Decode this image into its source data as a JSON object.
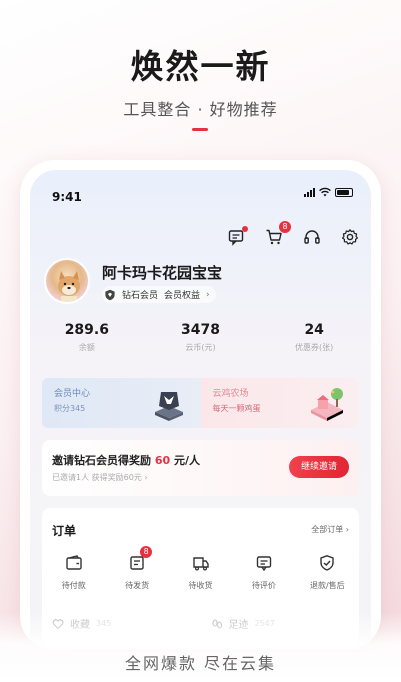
{
  "hero": {
    "title": "焕然一新",
    "subtitle": "工具整合 · 好物推荐"
  },
  "status_bar": {
    "time": "9:41"
  },
  "top_icons": [
    {
      "name": "message-icon",
      "has_dot": true
    },
    {
      "name": "cart-icon",
      "badge": "8"
    },
    {
      "name": "headset-icon"
    },
    {
      "name": "gear-icon"
    }
  ],
  "profile": {
    "name": "阿卡玛卡花园宝宝",
    "member_level": "钻石会员",
    "member_rights": "会员权益"
  },
  "stats": [
    {
      "value": "289.6",
      "label": "余额"
    },
    {
      "value": "3478",
      "label": "云币(元)"
    },
    {
      "value": "24",
      "label": "优惠券(张)"
    }
  ],
  "cards": {
    "member": {
      "title": "会员中心",
      "sub": "积分345"
    },
    "farm": {
      "title": "云鸡农场",
      "sub": "每天一颗鸡蛋"
    }
  },
  "invite": {
    "title_prefix": "邀请钻石会员得奖励",
    "amount": "60",
    "title_suffix": "元/人",
    "sub": "已邀请1人 获得奖励60元",
    "button": "继续邀请"
  },
  "orders": {
    "title": "订单",
    "all_label": "全部订单",
    "items": [
      {
        "label": "待付款",
        "icon": "wallet-icon"
      },
      {
        "label": "待发货",
        "icon": "package-icon",
        "badge": "8"
      },
      {
        "label": "待收货",
        "icon": "truck-icon"
      },
      {
        "label": "待评价",
        "icon": "comment-icon"
      },
      {
        "label": "退款/售后",
        "icon": "shield-check-icon"
      }
    ],
    "bottom": [
      {
        "label": "收藏",
        "count": "345",
        "icon": "heart-icon"
      },
      {
        "label": "足迹",
        "count": "2547",
        "icon": "footprint-icon"
      }
    ]
  },
  "footer": "全网爆款 尽在云集",
  "colors": {
    "accent": "#e8313f"
  }
}
